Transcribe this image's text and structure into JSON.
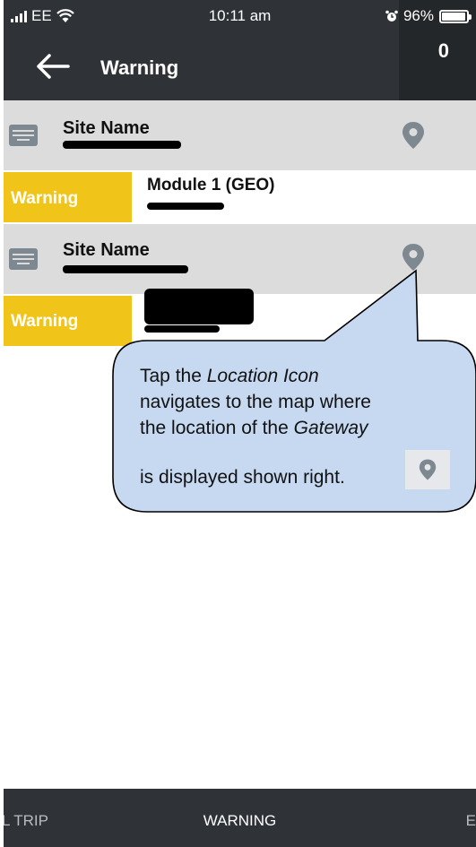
{
  "status_bar": {
    "carrier": "EE",
    "time": "10:11 am",
    "battery": "96%",
    "battery_level": 0.96
  },
  "header": {
    "title": "Warning",
    "count": "0"
  },
  "list": [
    {
      "site_label": "Site Name",
      "alert_label": "Warning",
      "module": "Module 1 (GEO)"
    },
    {
      "site_label": "Site Name",
      "alert_label": "Warning",
      "module": ""
    }
  ],
  "callout": {
    "line1_prefix": "Tap the ",
    "line1_em": "Location Icon",
    "line2": "navigates to the map where",
    "line3_prefix": "the location of the ",
    "line3_em": "Gateway",
    "line4": "is displayed shown right."
  },
  "tabs": {
    "left": "L TRIP",
    "center": "WARNING",
    "right": "E"
  },
  "colors": {
    "header_bg": "#2f3337",
    "warning_yellow": "#f0c419",
    "row_grey": "#dcdcdd",
    "callout_fill": "#c6d9f1",
    "icon_grey": "#7e8891"
  }
}
